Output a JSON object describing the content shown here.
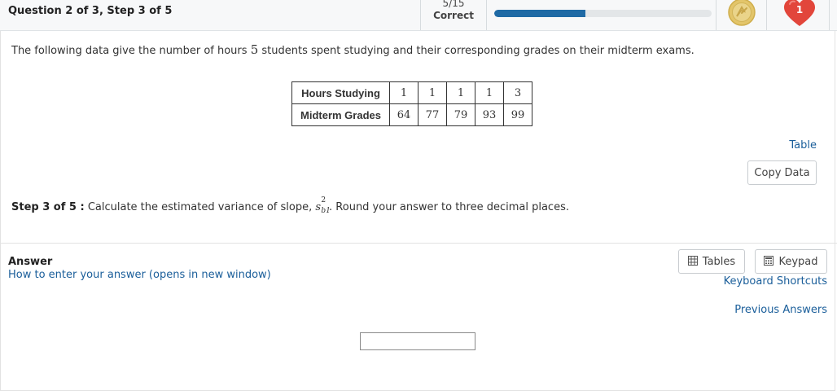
{
  "header": {
    "title": "Question 2 of 3, Step 3 of 5",
    "score_fraction": "5/15",
    "score_label": "Correct",
    "progress_fraction": 0.42,
    "medal_icon": "medal-icon",
    "lives_count": "1",
    "lives_icon": "heart-icon",
    "accent_color": "#1f6aa5",
    "heart_color": "#e2463b",
    "medal_color": "#e3c56a"
  },
  "question": {
    "prompt_before": "The following data give the number of hours",
    "prompt_number": "5",
    "prompt_after": "students spent studying and their corresponding grades on their midterm exams.",
    "table": {
      "rows": [
        {
          "label": "Hours Studying",
          "values": [
            "1",
            "1",
            "1",
            "1",
            "3"
          ]
        },
        {
          "label": "Midterm Grades",
          "values": [
            "64",
            "77",
            "79",
            "93",
            "99"
          ]
        }
      ]
    },
    "table_link": "Table",
    "copy_data_label": "Copy Data",
    "step_label": "Step 3 of 5 :",
    "step_text_before": "Calculate the estimated variance of slope,",
    "step_symbol": "s",
    "step_sup": "2",
    "step_sub": "b1",
    "step_text_after": ". Round your answer to three decimal places."
  },
  "answer": {
    "label": "Answer",
    "howto_link": "How to enter your answer (opens in new window)",
    "tables_button": "Tables",
    "tables_icon": "table-grid-icon",
    "keypad_button": "Keypad",
    "keypad_icon": "keypad-icon",
    "keyboard_shortcuts_link": "Keyboard Shortcuts",
    "previous_answers_link": "Previous Answers",
    "input_value": ""
  }
}
